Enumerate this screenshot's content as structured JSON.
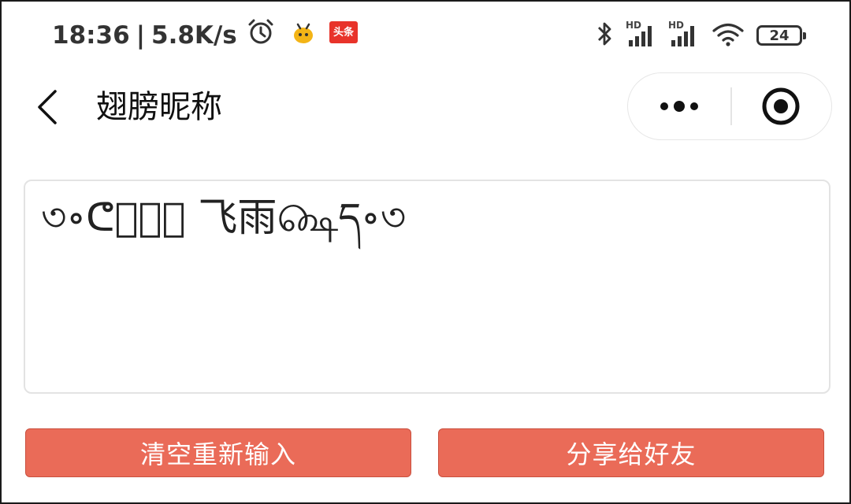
{
  "status_bar": {
    "time": "18:36",
    "separator": "|",
    "network_speed": "5.8K/s",
    "left_icons": [
      "alarm-clock-icon",
      "bee-app-icon",
      "toutiao-app-icon"
    ],
    "toutiao_label": "头条",
    "right_icons": [
      "bluetooth-icon",
      "signal-hd-icon",
      "signal-hd-icon",
      "wifi-icon"
    ],
    "hd_label": "HD",
    "battery_level": "24"
  },
  "navbar": {
    "title": "翅膀昵称",
    "back_icon": "chevron-left-icon",
    "capsule_more_icon": "more-dots-icon",
    "capsule_close_icon": "target-close-icon"
  },
  "nickname": {
    "value": "৩∘ᕦ௸͓͓ 飞雨௸ད∘৩"
  },
  "buttons": {
    "clear_label": "清空重新输入",
    "share_label": "分享给好友"
  },
  "colors": {
    "button_bg": "#ea6b58",
    "button_text": "#ffffff",
    "toutiao_red": "#e8332a",
    "bee_yellow": "#f3b416"
  }
}
